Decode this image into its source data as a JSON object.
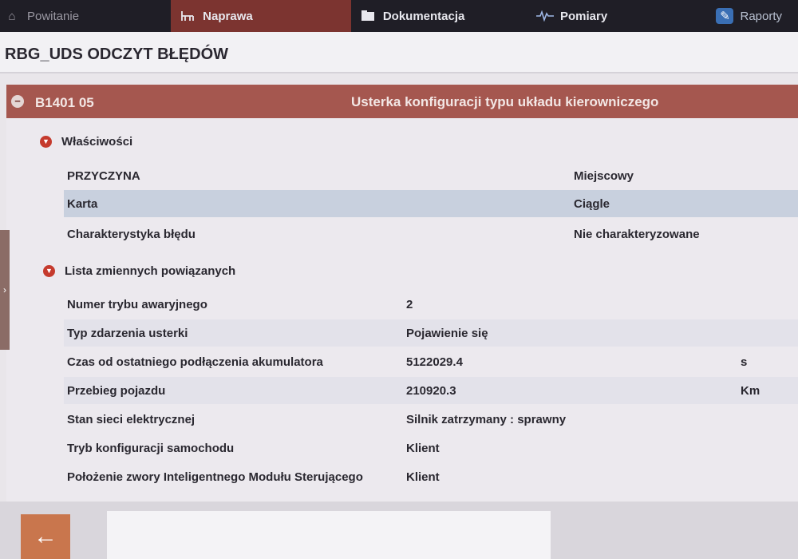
{
  "nav": {
    "tabs": [
      {
        "label": "Powitanie",
        "icon": "home-icon"
      },
      {
        "label": "Naprawa",
        "icon": "workbench-icon"
      },
      {
        "label": "Dokumentacja",
        "icon": "folder-icon"
      },
      {
        "label": "Pomiary",
        "icon": "waveform-icon"
      },
      {
        "label": "Raporty",
        "icon": "report-icon"
      }
    ],
    "active": "Naprawa"
  },
  "page": {
    "title": "RBG_UDS ODCZYT BŁĘDÓW"
  },
  "fault": {
    "code": "B1401 05",
    "description": "Usterka konfiguracji typu układu kierowniczego",
    "collapse_symbol": "−"
  },
  "properties": {
    "heading": "Właściwości",
    "rows": [
      {
        "label": "PRZYCZYNA",
        "value": "Miejscowy"
      },
      {
        "label": "Karta",
        "value": "Ciągle"
      },
      {
        "label": "Charakterystyka błędu",
        "value": "Nie charakteryzowane"
      }
    ]
  },
  "variables": {
    "heading": "Lista zmiennych powiązanych",
    "rows": [
      {
        "label": "Numer trybu awaryjnego",
        "value": "2",
        "unit": ""
      },
      {
        "label": "Typ zdarzenia usterki",
        "value": "Pojawienie się",
        "unit": ""
      },
      {
        "label": "Czas od ostatniego podłączenia akumulatora",
        "value": "5122029.4",
        "unit": "s"
      },
      {
        "label": "Przebieg pojazdu",
        "value": "210920.3",
        "unit": "Km"
      },
      {
        "label": "Stan sieci elektrycznej",
        "value": "Silnik zatrzymany : sprawny",
        "unit": ""
      },
      {
        "label": "Tryb konfiguracji samochodu",
        "value": "Klient",
        "unit": ""
      },
      {
        "label": "Położenie zwory Inteligentnego Modułu Sterującego",
        "value": "Klient",
        "unit": ""
      }
    ]
  },
  "colors": {
    "nav_bg": "#1f1e26",
    "active_tab": "#7c3430",
    "fault_bar": "#a5574f",
    "highlight_row": "#c8d0de",
    "back_button": "#c9764d"
  }
}
